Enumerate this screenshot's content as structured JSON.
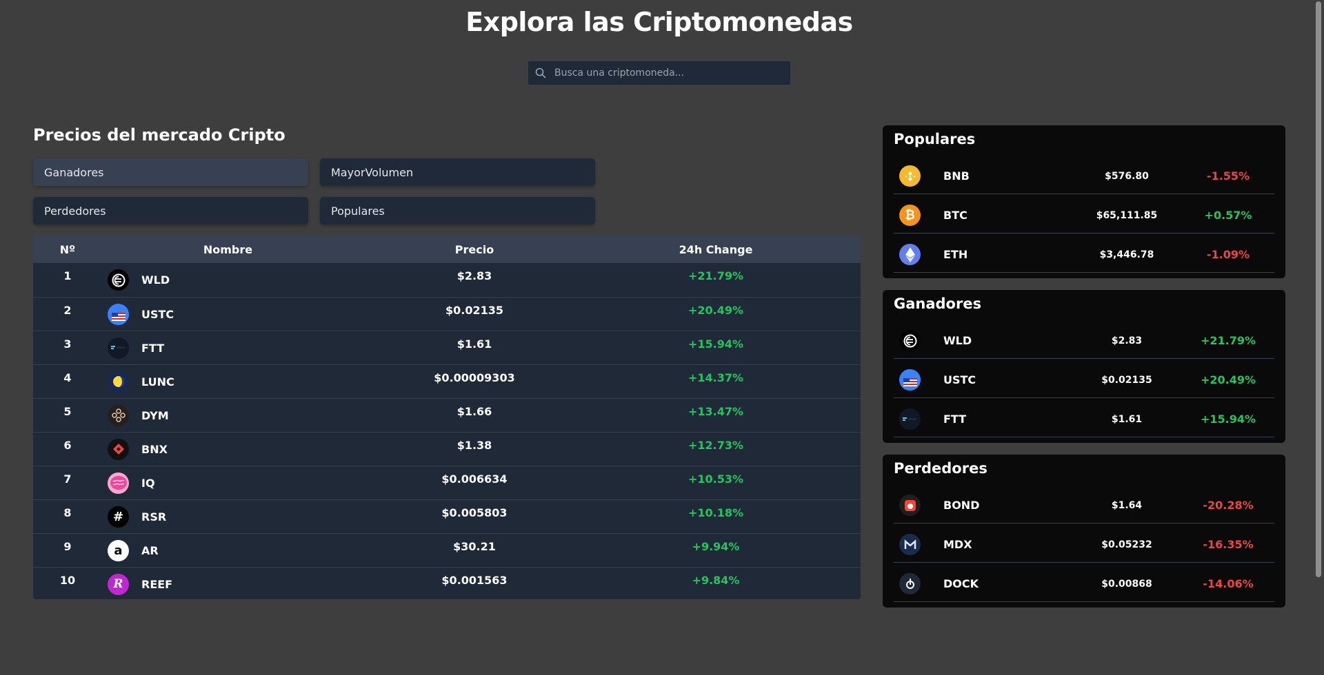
{
  "header": {
    "title": "Explora las Criptomonedas",
    "search_placeholder": "Busca una criptomoneda..."
  },
  "market": {
    "title": "Precios del mercado Cripto",
    "filters": [
      "Ganadores",
      "MayorVolumen",
      "Perdedores",
      "Populares"
    ],
    "active_filter": "Ganadores",
    "columns": [
      "Nº",
      "Nombre",
      "Precio",
      "24h Change"
    ],
    "rows": [
      {
        "num": "1",
        "symbol": "WLD",
        "price": "$2.83",
        "change": "+21.79%",
        "icon": "worldcoin-icon"
      },
      {
        "num": "2",
        "symbol": "USTC",
        "price": "$0.02135",
        "change": "+20.49%",
        "icon": "ustc-flag-icon"
      },
      {
        "num": "3",
        "symbol": "FTT",
        "price": "$1.61",
        "change": "+15.94%",
        "icon": "ftx-token-icon"
      },
      {
        "num": "4",
        "symbol": "LUNC",
        "price": "$0.00009303",
        "change": "+14.37%",
        "icon": "terra-classic-icon"
      },
      {
        "num": "5",
        "symbol": "DYM",
        "price": "$1.66",
        "change": "+13.47%",
        "icon": "dymension-icon"
      },
      {
        "num": "6",
        "symbol": "BNX",
        "price": "$1.38",
        "change": "+12.73%",
        "icon": "binaryx-icon"
      },
      {
        "num": "7",
        "symbol": "IQ",
        "price": "$0.006634",
        "change": "+10.53%",
        "icon": "iq-brain-icon"
      },
      {
        "num": "8",
        "symbol": "RSR",
        "price": "$0.005803",
        "change": "+10.18%",
        "icon": "reserve-rights-icon"
      },
      {
        "num": "9",
        "symbol": "AR",
        "price": "$30.21",
        "change": "+9.94%",
        "icon": "arweave-icon"
      },
      {
        "num": "10",
        "symbol": "REEF",
        "price": "$0.001563",
        "change": "+9.84%",
        "icon": "reef-icon"
      }
    ]
  },
  "panels": [
    {
      "title": "Populares",
      "rows": [
        {
          "symbol": "BNB",
          "price": "$576.80",
          "change": "-1.55%",
          "trend": "neg",
          "icon": "bnb-icon"
        },
        {
          "symbol": "BTC",
          "price": "$65,111.85",
          "change": "+0.57%",
          "trend": "pos",
          "icon": "bitcoin-icon"
        },
        {
          "symbol": "ETH",
          "price": "$3,446.78",
          "change": "-1.09%",
          "trend": "neg",
          "icon": "ethereum-icon"
        }
      ]
    },
    {
      "title": "Ganadores",
      "rows": [
        {
          "symbol": "WLD",
          "price": "$2.83",
          "change": "+21.79%",
          "trend": "pos",
          "icon": "worldcoin-icon"
        },
        {
          "symbol": "USTC",
          "price": "$0.02135",
          "change": "+20.49%",
          "trend": "pos",
          "icon": "ustc-flag-icon"
        },
        {
          "symbol": "FTT",
          "price": "$1.61",
          "change": "+15.94%",
          "trend": "pos",
          "icon": "ftx-token-icon"
        }
      ]
    },
    {
      "title": "Perdedores",
      "rows": [
        {
          "symbol": "BOND",
          "price": "$1.64",
          "change": "-20.28%",
          "trend": "neg",
          "icon": "barnbridge-icon"
        },
        {
          "symbol": "MDX",
          "price": "$0.05232",
          "change": "-16.35%",
          "trend": "neg",
          "icon": "mdex-icon"
        },
        {
          "symbol": "DOCK",
          "price": "$0.00868",
          "change": "-14.06%",
          "trend": "neg",
          "icon": "dock-icon"
        }
      ]
    }
  ],
  "colors": {
    "background": "#3d3e3d",
    "positive": "#22c55e",
    "negative": "#ef4444",
    "table_bg": "#1f2937",
    "table_header": "#374151",
    "panel_bg": "#0a0a0b"
  }
}
